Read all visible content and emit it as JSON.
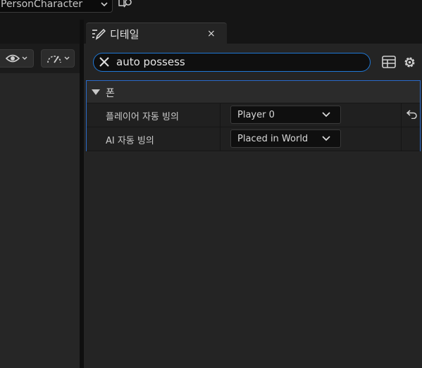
{
  "topbar": {
    "class_dropdown_text": "PersonCharacter",
    "browse_icon": "browse-to-asset-icon"
  },
  "viewport_toolbar": {
    "eye_icon": "eye-icon",
    "speed_icon": "camera-speed-icon"
  },
  "details": {
    "tab_title": "디테일",
    "tab_close": "×",
    "search_value": "auto possess",
    "category": "폰",
    "properties": [
      {
        "name": "플레이어 자동 빙의",
        "value": "Player 0",
        "has_reset": true
      },
      {
        "name": "AI 자동 빙의",
        "value": "Placed in World",
        "has_reset": false
      }
    ]
  },
  "colors": {
    "accent": "#1f78d6",
    "panel_bg": "#242424",
    "border_highlight": "#2a6ac8"
  }
}
